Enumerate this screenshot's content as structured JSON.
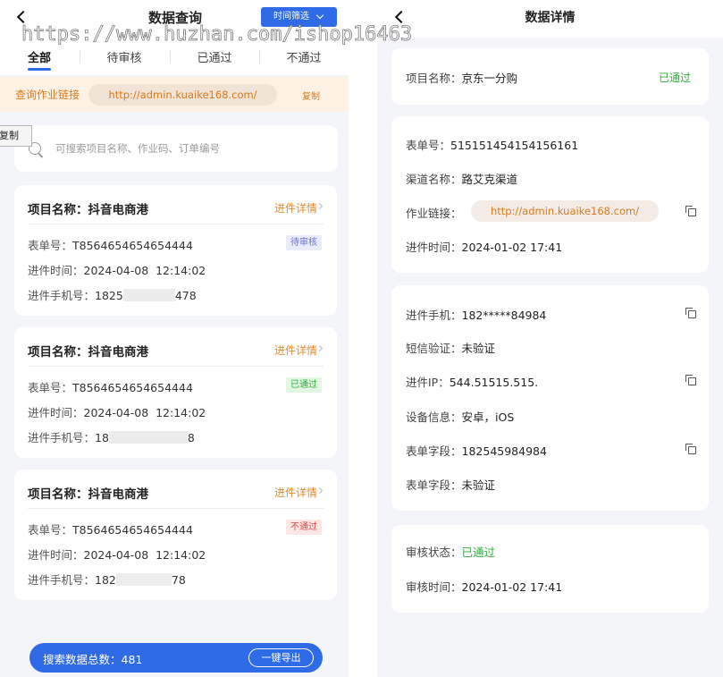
{
  "watermark": "https://www.huzhan.com/ishop16463",
  "left": {
    "title": "数据查询",
    "time_filter": "时间筛选",
    "tabs": [
      "全部",
      "待审核",
      "已通过",
      "不通过"
    ],
    "link_label": "查询作业链接",
    "link_url": "http://admin.kuaike168.com/",
    "copy_label": "复制",
    "copy_tooltip": "复制",
    "search_placeholder": "可搜索项目名称、作业码、订单编号",
    "cards": [
      {
        "project_label": "项目名称：",
        "project_name": "抖音电商港",
        "detail_link": "进件详情",
        "order_label": "表单号：",
        "order_no": "T8564654654654444",
        "time_label": "进件时间：",
        "time": "2024-04-08  12:14:02",
        "phone_label": "进件手机号：",
        "phone_prefix": "1825",
        "phone_suffix": "478",
        "status": "待审核"
      },
      {
        "project_label": "项目名称：",
        "project_name": "抖音电商港",
        "detail_link": "进件详情",
        "order_label": "表单号：",
        "order_no": "T8564654654654444",
        "time_label": "进件时间：",
        "time": "2024-04-08  12:14:02",
        "phone_label": "进件手机号：",
        "phone_prefix": "18",
        "phone_suffix": "8",
        "status": "已通过"
      },
      {
        "project_label": "项目名称：",
        "project_name": "抖音电商港",
        "detail_link": "进件详情",
        "order_label": "表单号：",
        "order_no": "T8564654654654444",
        "time_label": "进件时间：",
        "time": "2024-04-08  12:14:02",
        "phone_label": "进件手机号：",
        "phone_prefix": "182",
        "phone_suffix": "78",
        "status": "不通过"
      }
    ],
    "total_label": "搜索数据总数：",
    "total_count": "481",
    "export_button": "一键导出"
  },
  "right": {
    "title": "数据详情",
    "project": {
      "label": "项目名称：",
      "value": "京东一分购",
      "status": "已通过"
    },
    "order": {
      "label": "表单号：",
      "value": "515151454154156161"
    },
    "channel": {
      "label": "渠道名称：",
      "value": "路艾克渠道"
    },
    "link": {
      "label": "作业链接：",
      "value": "http://admin.kuaike168.com/"
    },
    "submit_time": {
      "label": "进件时间：",
      "value": "2024-01-02 17:41"
    },
    "phone": {
      "label": "进件手机：",
      "value": "182*****84984"
    },
    "sms": {
      "label": "短信验证：",
      "value": "未验证"
    },
    "ip": {
      "label": "进件IP：",
      "value": "544.51515.515."
    },
    "device": {
      "label": "设备信息：",
      "value": "安卓，iOS"
    },
    "form_field_1": {
      "label": "表单字段：",
      "value": "182545984984"
    },
    "form_field_2": {
      "label": "表单字段：",
      "value": "未验证"
    },
    "review_status": {
      "label": "审核状态：",
      "value": "已通过"
    },
    "review_time": {
      "label": "审核时间：",
      "value": "2024-01-02 17:41"
    }
  }
}
